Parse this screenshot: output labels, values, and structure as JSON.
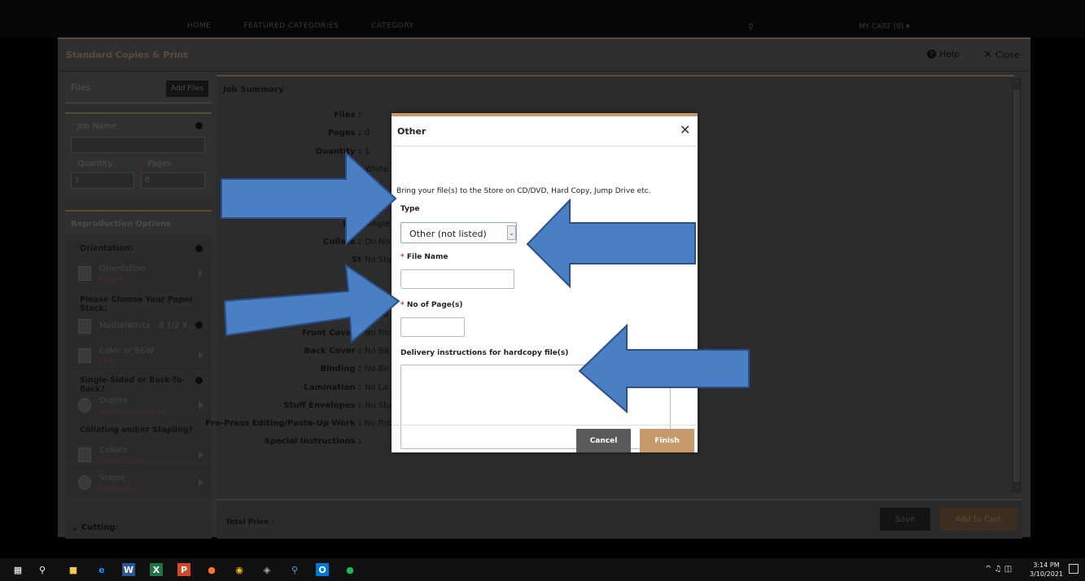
{
  "top_nav": {
    "links": [
      "HOME",
      "FEATURED CATEGORIES",
      "CATEGORY"
    ],
    "cart": "MY CART (0) ▾"
  },
  "window": {
    "title": "Standard Copies & Print",
    "help": "Help",
    "close": "Close"
  },
  "left": {
    "files_label": "Files",
    "add_files": "Add Files",
    "job_name_label": "Job Name",
    "quantity_label": "Quantity",
    "pages_label": "Pages",
    "quantity_value": "1",
    "pages_value": "0",
    "repro_title": "Reproduction Options",
    "orientation_head": "Orientation:",
    "orientation_name": "Orientation",
    "orientation_value": "Portrait",
    "paper_head": "Please Choose Your Paper Stock:",
    "media_name": "Media(White - 8 1/2 X ...",
    "color_name": "Color or B&W",
    "color_value": "B&W",
    "sided_head": "Single-Sided or Back-To-Back?",
    "duplex_name": "Duplex",
    "duplex_value": "Single-sided (simplex)",
    "collating_head": "Collating and/or Stapling?",
    "collate_name": "Collate",
    "collate_value": "Do Not Collate",
    "staple_name": "Staple",
    "staple_value": "No Stapling",
    "cutting": "Cutting:"
  },
  "summary": {
    "title": "Job Summary",
    "rows": [
      {
        "k": "Files :",
        "v": ""
      },
      {
        "k": "Pages :",
        "v": "0"
      },
      {
        "k": "Quantity :",
        "v": "1"
      },
      {
        "k": "Me",
        "v": "White"
      },
      {
        "k": "",
        "v": ""
      },
      {
        "k": "",
        "v": "B&W"
      },
      {
        "k": "Dup",
        "v": "Single"
      },
      {
        "k": "Collate :",
        "v": "Do No"
      },
      {
        "k": "St",
        "v": "No Sta"
      },
      {
        "k": "",
        "v": ""
      },
      {
        "k": "",
        "v": "o Fol"
      },
      {
        "k": "Punc",
        "v": "No Pu"
      },
      {
        "k": "Front Cover :",
        "v": "No Fro"
      },
      {
        "k": "Back Cover :",
        "v": "No Ba"
      },
      {
        "k": "Binding :",
        "v": "No Bir"
      },
      {
        "k": "Lamination :",
        "v": "No La"
      },
      {
        "k": "Stuff Envelopes :",
        "v": "No Stu"
      },
      {
        "k": "Pre-Press Editing/Paste-Up Work :",
        "v": "No Pre-Press Editing/Paste-Up Work"
      },
      {
        "k": "Special Instructions :",
        "v": ""
      }
    ],
    "total_price": "Total Price -",
    "save": "Save",
    "add_to_cart": "Add to Cart"
  },
  "dialog": {
    "title": "Other",
    "intro": "Bring your file(s) to the Store on CD/DVD, Hard Copy, Jump Drive etc.",
    "type_label": "Type",
    "type_value": "Other (not listed)",
    "file_name_label": "File Name",
    "pages_label": "No of Page(s)",
    "delivery_label": "Delivery instructions for hardcopy file(s)",
    "cancel": "Cancel",
    "finish": "Finish",
    "file_name_value": "",
    "pages_value": "",
    "delivery_value": ""
  },
  "taskbar": {
    "time": "3:14 PM",
    "date": "3/10/2021"
  },
  "colors": {
    "accent": "#c79a6c",
    "arrow_fill": "#4a7fc4",
    "arrow_stroke": "#2a4f8a"
  }
}
